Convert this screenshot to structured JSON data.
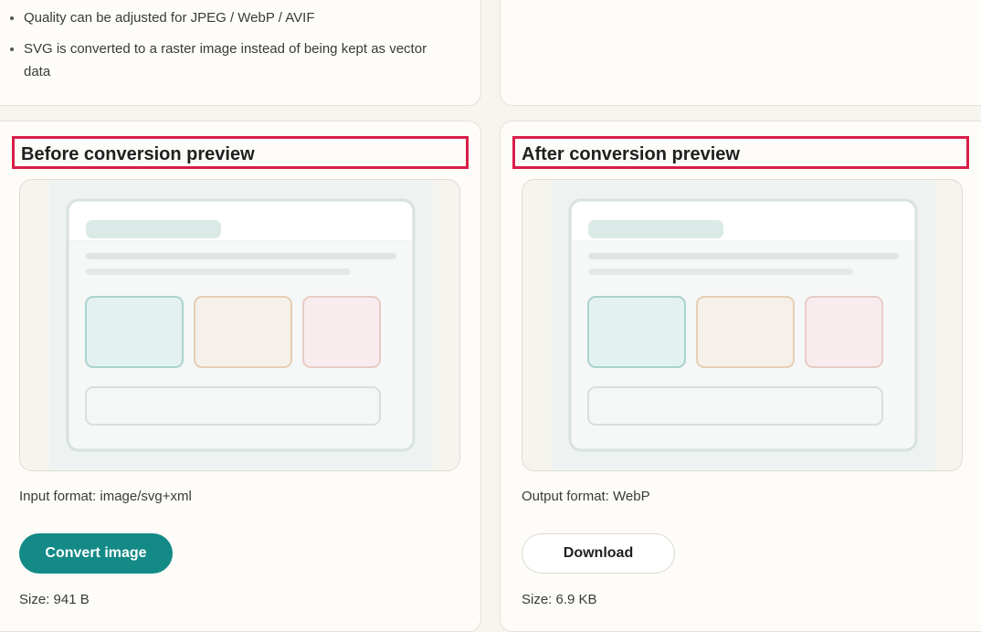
{
  "notes": [
    "Quality can be adjusted for JPEG / WebP / AVIF",
    "SVG is converted to a raster image instead of being kept as vector data"
  ],
  "before": {
    "title": "Before conversion preview",
    "format": "Input format: image/svg+xml",
    "button": "Convert image",
    "size": "Size: 941 B"
  },
  "after": {
    "title": "After conversion preview",
    "format": "Output format: WebP",
    "button": "Download",
    "size": "Size: 6.9 KB"
  },
  "colors": {
    "highlight_border": "#d81e4a",
    "primary_button": "#138a86",
    "tile_teal": "#e3f2f0",
    "tile_sand": "#f5f1ea",
    "tile_pink": "#f8ecee"
  }
}
